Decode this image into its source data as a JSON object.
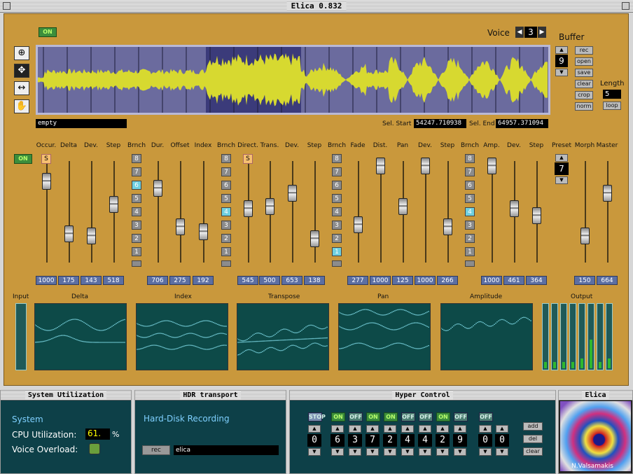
{
  "window": {
    "title": "Elica 0.832"
  },
  "top": {
    "on_label": "ON",
    "voice_label": "Voice",
    "voice_value": "3",
    "buffer_label": "Buffer",
    "buffer_value": "9",
    "length_label": "Length",
    "length_value": "5",
    "loop_label": "loop"
  },
  "buffer_buttons": [
    "rec",
    "open",
    "save",
    "clear",
    "crop",
    "norm"
  ],
  "file_name": "empty",
  "selection": {
    "start_label": "Sel. Start",
    "start_value": "54247.710938",
    "end_label": "Sel. End",
    "end_value": "64957.371094"
  },
  "params": {
    "on_label": "ON",
    "preset_label": "Preset",
    "preset_value": "7",
    "s_label": "S",
    "labels": [
      "Occur.",
      "Delta",
      "Dev.",
      "Step",
      "Brnch",
      "Dur.",
      "Offset",
      "Index",
      "Brnch",
      "Direct.",
      "Trans.",
      "Dev.",
      "Step",
      "Brnch",
      "Fade",
      "Dist.",
      "Pan",
      "Dev.",
      "Step",
      "Brnch",
      "Amp.",
      "Dev.",
      "Step",
      "Preset",
      "Morph",
      "Master"
    ],
    "values": [
      "1000",
      "175",
      "143",
      "518",
      "706",
      "275",
      "192",
      "545",
      "500",
      "653",
      "138",
      "277",
      "1000",
      "125",
      "1000",
      "266",
      "1000",
      "461",
      "364",
      "150",
      "664"
    ],
    "branch_numbers": [
      "8",
      "7",
      "6",
      "5",
      "4",
      "3",
      "2",
      "1"
    ]
  },
  "scopes": {
    "input": "Input",
    "delta": "Delta",
    "index": "Index",
    "transpose": "Transpose",
    "pan": "Pan",
    "amplitude": "Amplitude",
    "output": "Output"
  },
  "output_levels": [
    0.1,
    0.1,
    0.1,
    0.1,
    0.15,
    0.45,
    0.1,
    0.15
  ],
  "system": {
    "title": "System Utilization",
    "heading": "System",
    "cpu_label": "CPU Utilization:",
    "cpu_value": "61.",
    "cpu_unit": "%",
    "overload_label": "Voice Overload:"
  },
  "hdr": {
    "title": "HDR transport",
    "heading": "Hard-Disk Recording",
    "rec_label": "rec",
    "file": "elica"
  },
  "hyper": {
    "title": "Hyper Control",
    "stop": "STOP",
    "toggles": [
      "ON",
      "OFF",
      "ON",
      "ON",
      "OFF",
      "OFF",
      "ON",
      "OFF",
      "OFF"
    ],
    "digits": [
      "0",
      "6",
      "3",
      "7",
      "2",
      "4",
      "4",
      "2",
      "9",
      "0",
      "0"
    ],
    "buttons": [
      "add",
      "del",
      "clear"
    ]
  },
  "elica": {
    "title": "Elica",
    "credit": "N.Valsamakis"
  }
}
